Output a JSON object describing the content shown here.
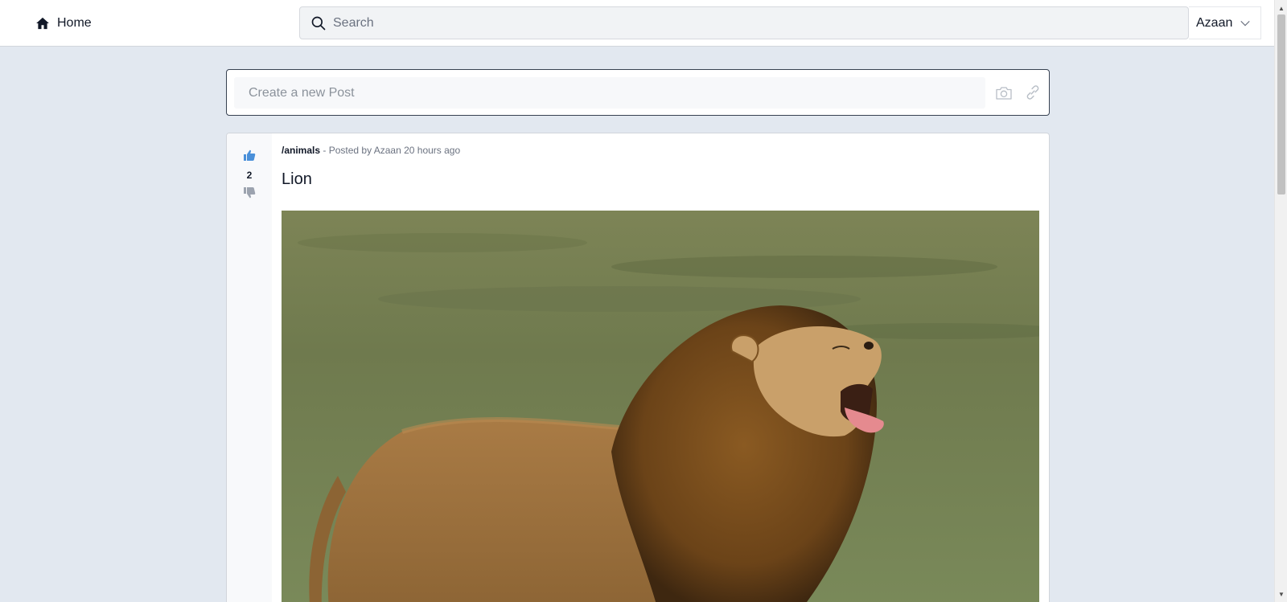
{
  "nav": {
    "home_label": "Home",
    "search_placeholder": "Search",
    "user_name": "Azaan"
  },
  "create_post": {
    "placeholder": "Create a new Post"
  },
  "post": {
    "community": "/animals",
    "meta_text": " - Posted by Azaan 20 hours ago",
    "score": "2",
    "title": "Lion",
    "image_subject": "lion"
  },
  "colors": {
    "upvote": "#4a90d9",
    "downvote": "#9ca3af",
    "background": "#e2e8f0"
  }
}
